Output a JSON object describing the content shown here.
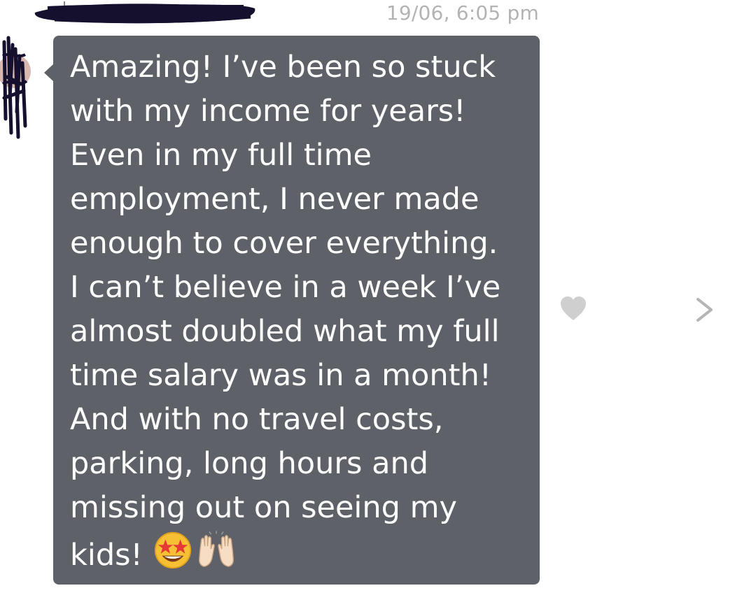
{
  "header": {
    "timestamp": "19/06, 6:05 pm"
  },
  "message": {
    "text": "Amazing! I’ve been so stuck\nwith my income for years!\nEven in my full time\nemployment, I never made\nenough to cover everything.\nI can’t believe in a week I’ve\nalmost doubled what my full\ntime salary was in a month!\nAnd with no travel costs,\nparking, long hours and\nmissing out on seeing my\nkids!",
    "emojis": [
      "star-struck-emoji",
      "raising-hands-emoji"
    ]
  },
  "icons": {
    "like": "heart-icon",
    "next": "chevron-right-icon"
  },
  "colors": {
    "bubble": "#5e6268",
    "timestamp": "#b3b3b3",
    "heart": "#cfcfcf",
    "redaction": "#14102e"
  }
}
